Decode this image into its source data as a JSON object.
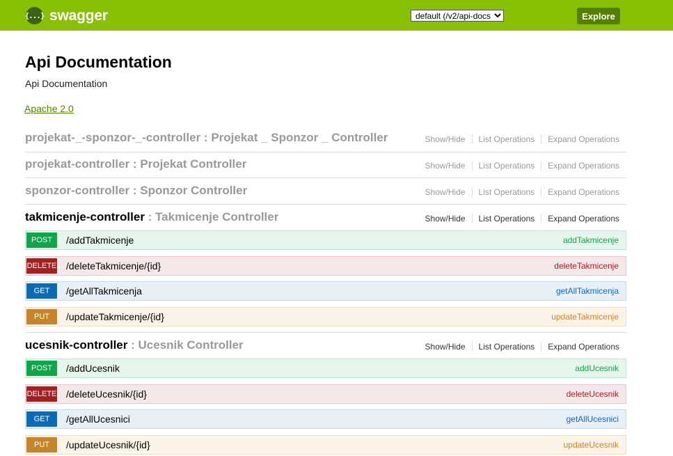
{
  "header": {
    "logo_glyph": "{...}",
    "logo_text": "swagger",
    "spec_selected": "default (/v2/api-docs)",
    "explore_label": "Explore",
    "brand_color": "#89bf04"
  },
  "info": {
    "title": "Api Documentation",
    "description": "Api Documentation",
    "license": "Apache 2.0"
  },
  "ops_labels": {
    "show_hide": "Show/Hide",
    "list_operations": "List Operations",
    "expand_operations": "Expand Operations"
  },
  "resources": [
    {
      "path": "projekat-_-sponzor-_-controller",
      "sep": " : ",
      "description": "Projekat _ Sponzor _ Controller"
    },
    {
      "path": "projekat-controller",
      "sep": " : ",
      "description": "Projekat Controller"
    },
    {
      "path": "sponzor-controller",
      "sep": " : ",
      "description": "Sponzor Controller"
    },
    {
      "path": "takmicenje-controller",
      "sep": " : ",
      "description": "Takmicenje Controller",
      "operations": [
        {
          "method": "POST",
          "path": "/addTakmicenje",
          "nickname": "addTakmicenje"
        },
        {
          "method": "DELETE",
          "path": "/deleteTakmicenje/{id}",
          "nickname": "deleteTakmicenje"
        },
        {
          "method": "GET",
          "path": "/getAllTakmicenja",
          "nickname": "getAllTakmicenja"
        },
        {
          "method": "PUT",
          "path": "/updateTakmicenje/{id}",
          "nickname": "updateTakmicenje"
        }
      ]
    },
    {
      "path": "ucesnik-controller",
      "sep": " : ",
      "description": "Ucesnik Controller",
      "operations": [
        {
          "method": "POST",
          "path": "/addUcesnik",
          "nickname": "addUcesnik"
        },
        {
          "method": "DELETE",
          "path": "/deleteUcesnik/{id}",
          "nickname": "deleteUcesnik"
        },
        {
          "method": "GET",
          "path": "/getAllUcesnici",
          "nickname": "getAllUcesnici"
        },
        {
          "method": "PUT",
          "path": "/updateUcesnik/{id}",
          "nickname": "updateUcesnik"
        }
      ]
    }
  ],
  "method_colors": {
    "POST": "#10a54a",
    "DELETE": "#a41e22",
    "GET": "#0f6ab4",
    "PUT": "#c5862b"
  }
}
